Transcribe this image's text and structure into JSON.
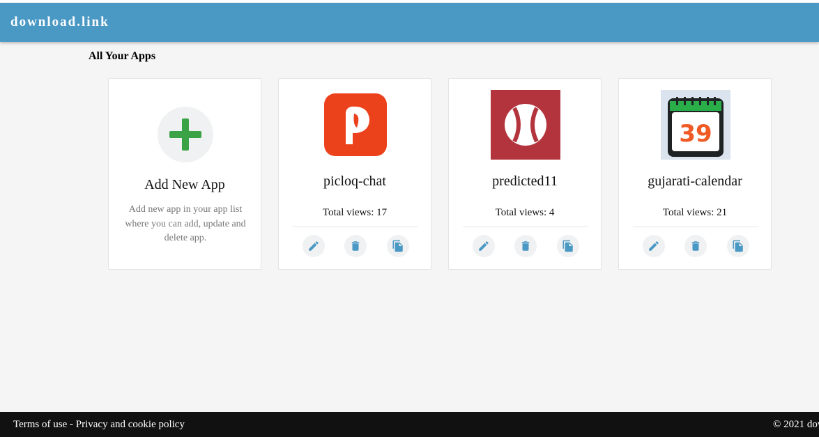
{
  "header": {
    "brand": "download.link",
    "color": "#4a98c4"
  },
  "page": {
    "section_title": "All Your Apps"
  },
  "add_card": {
    "icon": "plus-icon",
    "title": "Add New App",
    "description": "Add new app in your app list where you can add, update and delete app."
  },
  "apps": [
    {
      "name": "picloq-chat",
      "views": "Total views: 17",
      "icon": "picloq-logo-icon"
    },
    {
      "name": "predicted11",
      "views": "Total views: 4",
      "icon": "baseball-icon"
    },
    {
      "name": "gujarati-calendar",
      "views": "Total views: 21",
      "icon": "calendar-icon",
      "calendar_number": "39"
    }
  ],
  "actions": {
    "edit_icon": "pencil-icon",
    "delete_icon": "trash-icon",
    "copy_icon": "copy-icon",
    "color": "#4a98c4"
  },
  "footer": {
    "terms": "Terms of use",
    "separator": "-",
    "privacy": "Privacy and cookie policy",
    "copyright": "© 2021 dov"
  }
}
